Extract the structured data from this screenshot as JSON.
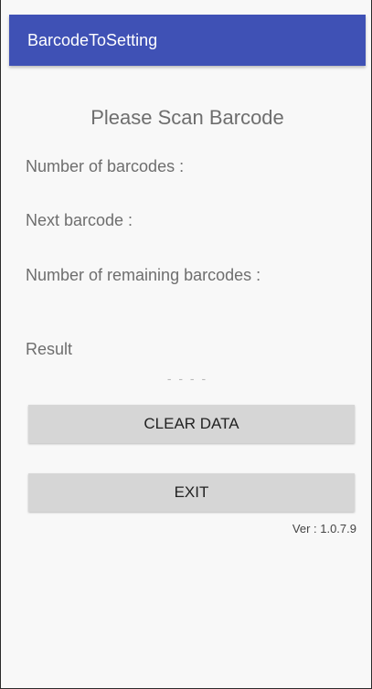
{
  "app_bar": {
    "title": "BarcodeToSetting",
    "background_color": "#3f51b5"
  },
  "main": {
    "scan_title": "Please Scan Barcode",
    "labels": {
      "number_of_barcodes": "Number of barcodes :",
      "next_barcode": "Next barcode :",
      "remaining_barcodes": "Number of remaining barcodes :",
      "result": "Result"
    },
    "result_value": "- - - -",
    "buttons": {
      "clear_data": "CLEAR DATA",
      "exit": "EXIT"
    },
    "version": "Ver : 1.0.7.9"
  }
}
